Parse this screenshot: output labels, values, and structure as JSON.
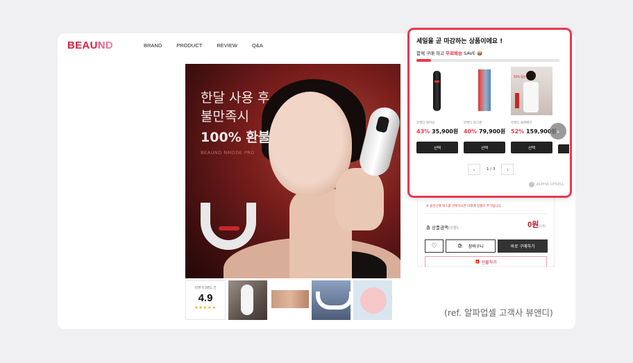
{
  "site": {
    "logo_main": "BEAU",
    "logo_accent": "ND",
    "nav": [
      "BRAND",
      "PRODUCT",
      "REVIEW",
      "Q&A"
    ]
  },
  "hero": {
    "line1": "한달 사용 후",
    "line2": "불만족시",
    "line3": "100% 환불",
    "sub": "BEAUND NMODE PRO"
  },
  "rating": {
    "count_label": "리뷰 6,881 건",
    "score": "4.9",
    "stars": "★★★★★"
  },
  "upsell": {
    "title": "세일을 곧 마감하는 상품이에요 !",
    "sub_prefix": "함께 구매 하고",
    "sub_highlight": "무료배송",
    "sub_suffix": "SAVE 📦",
    "progress": 0.1,
    "products": [
      {
        "name": "뷰앤디 레이팅",
        "discount": "43%",
        "price": "35,900원",
        "button": "선택"
      },
      {
        "name": "뷰앤디 레그핀",
        "discount": "40%",
        "price": "79,900원",
        "button": "선택"
      },
      {
        "name": "뷰앤디 슬랜페이",
        "discount": "52%",
        "price": "159,900원",
        "button": "선택",
        "image_text": "50% 할인"
      }
    ],
    "next_icon": "›",
    "pager_prev": "‹",
    "pager_text": "1 / 3",
    "pager_next": "›",
    "powered_by": "ALPHA UPSELL"
  },
  "order": {
    "notice": "※ 옵션선택 박스를 선택하시면 아래에 상품이 추가됩니다.",
    "total_label": "총 상품금액",
    "total_qty_label": "(수량)",
    "total_value": "0원",
    "total_count": "(0개)",
    "heart_icon": "♡",
    "cart_label": "장바구니",
    "buy_label": "바로 구매하기",
    "gift_label": "선물하기"
  },
  "reference_caption": "(ref. 알파업셀 고객사 뷰앤디)",
  "colors": {
    "accent": "#e8384f",
    "brand_red": "#d9213c",
    "background": "#f0f0f2"
  }
}
